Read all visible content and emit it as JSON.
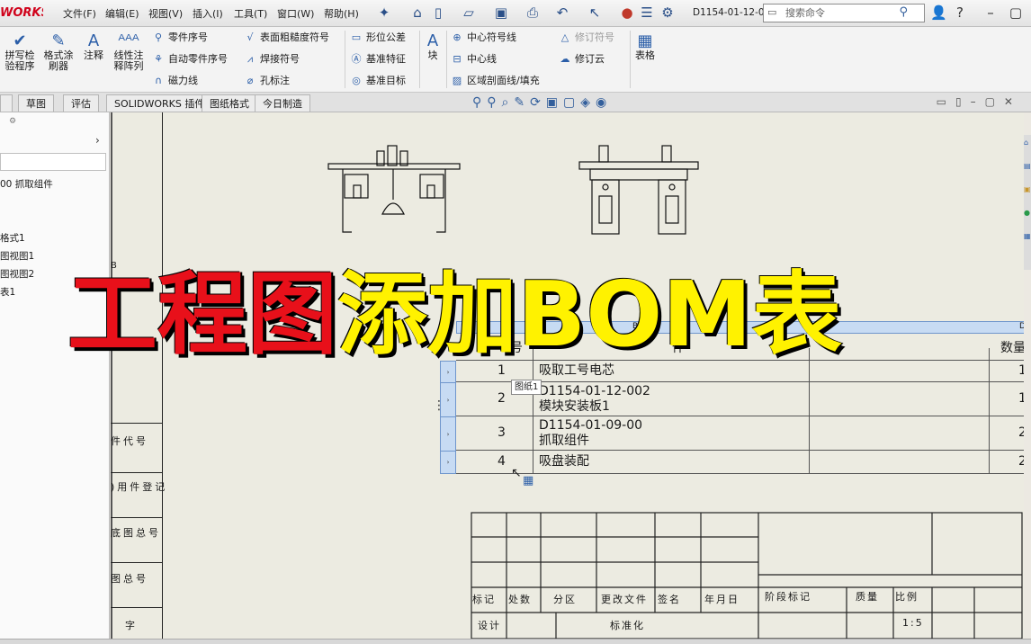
{
  "app": {
    "brand": "WORKS",
    "document_name": "D1154-01-12-0..."
  },
  "menu": [
    "文件(F)",
    "编辑(E)",
    "视图(V)",
    "插入(I)",
    "工具(T)",
    "窗口(W)",
    "帮助(H)"
  ],
  "search": {
    "placeholder": "搜索命令"
  },
  "ribbon": {
    "spellcheck": "拼写检\n验程序",
    "format_painter": "格式涂\n刷器",
    "annotation": "注释",
    "linear_note": "线性注\n释阵列",
    "balloon": "零件序号",
    "auto_balloon": "自动零件序号",
    "magnetic_line": "磁力线",
    "surface_finish": "表面粗糙度符号",
    "weld_symbol": "焊接符号",
    "hole_callout": "孔标注",
    "gtol": "形位公差",
    "datum_feature": "基准特征",
    "datum_target": "基准目标",
    "block": "块",
    "center_mark": "中心符号线",
    "centerline": "中心线",
    "area_hatch": "区域剖面线/填充",
    "revision_symbol": "修订符号",
    "revision_cloud": "修订云",
    "table": "表格"
  },
  "tabs": [
    "草图",
    "评估",
    "SOLIDWORKS 插件",
    "图纸格式",
    "今日制造"
  ],
  "sidebar": {
    "items": [
      "00 抓取组件",
      "格式1",
      "图视图1",
      "图视图2",
      "表1"
    ]
  },
  "frame": {
    "zone_b": "B",
    "labels": [
      "件代号",
      ")用件登记",
      "底图总号",
      "图总号",
      "字"
    ]
  },
  "bom": {
    "col_letters": [
      "B",
      "D"
    ],
    "headers": {
      "item_no": "号",
      "part_no": "件",
      "qty": "数量"
    },
    "rows": [
      {
        "item_no": "1",
        "part_no": "吸取工号电芯",
        "qty": "1"
      },
      {
        "item_no": "2",
        "part_no": "D1154-01-12-002\n模块安装板1",
        "qty": "1"
      },
      {
        "item_no": "3",
        "part_no": "D1154-01-09-00\n抓取组件",
        "qty": "2"
      },
      {
        "item_no": "4",
        "part_no": "吸盘装配",
        "qty": "2"
      }
    ]
  },
  "tooltip": "图纸1",
  "title_block": {
    "row_labels": [
      "标记",
      "处数",
      "分区",
      "更改文件",
      "签名",
      "年月日"
    ],
    "stage": "阶段标记",
    "weight": "质量",
    "scale": "比例",
    "scale_value": "1:5",
    "design": "设计",
    "standardize": "标准化"
  },
  "headline": {
    "part1": "工程图",
    "part2": "添加BOM表"
  },
  "colors": {
    "headline_red": "#e8101a",
    "headline_yellow": "#fff200",
    "table_highlight": "#c7dbf3"
  }
}
